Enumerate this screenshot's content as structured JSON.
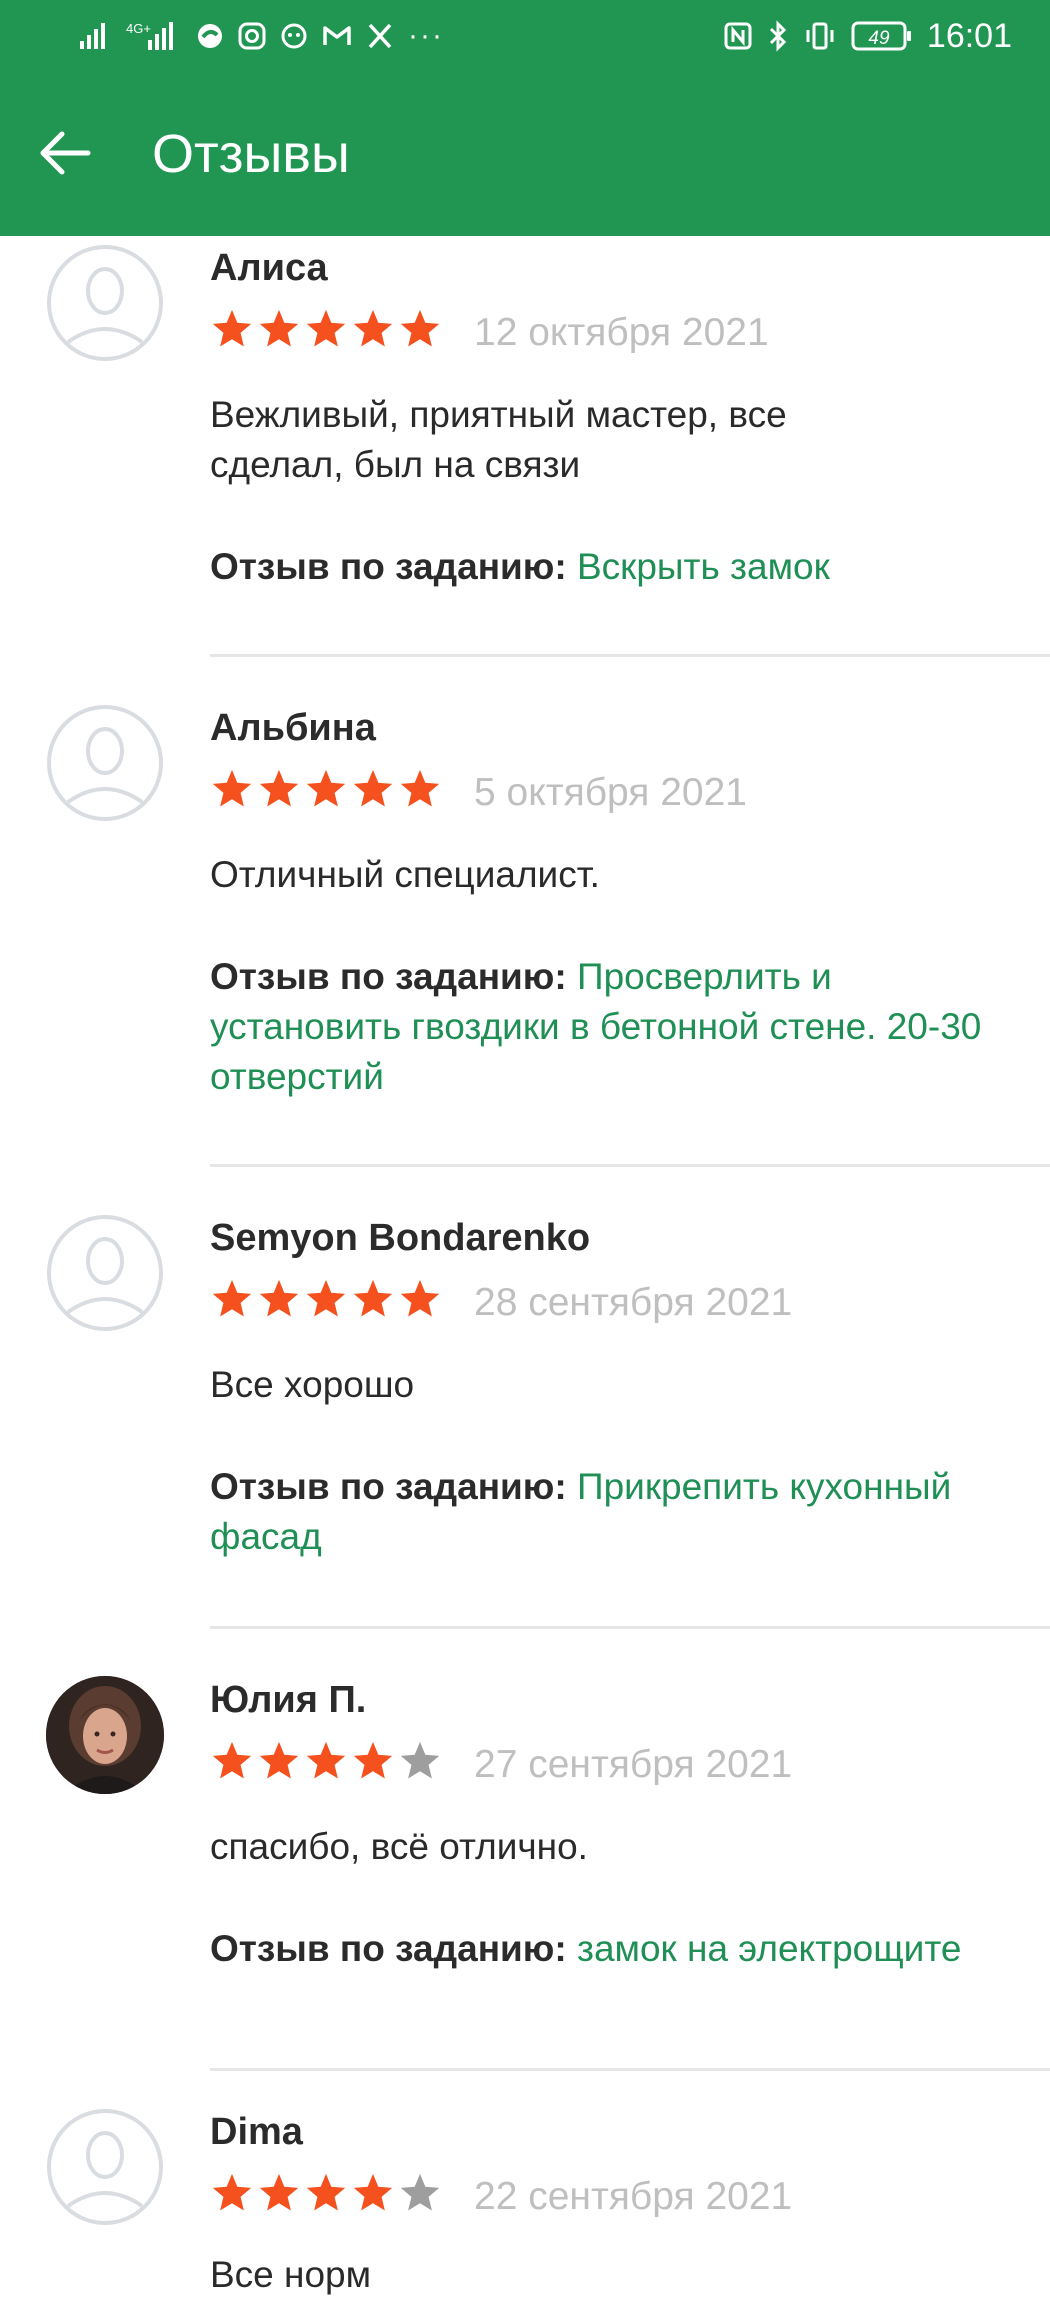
{
  "status_bar": {
    "signal1": "signal-icon",
    "network": "4G⁺",
    "more": "···",
    "time": "16:01",
    "battery": "49"
  },
  "app_bar": {
    "title": "Отзывы",
    "back_icon": "arrow-left-icon"
  },
  "colors": {
    "primary": "#219653",
    "link": "#1f8f55",
    "star_on": "#f4511e",
    "star_off": "#9e9e9e",
    "date": "#bfbfbf"
  },
  "task_label": "Отзыв по заданию:",
  "reviews": [
    {
      "name": "Алиса",
      "rating": 5,
      "date": "12 октября 2021",
      "text": "Вежливый, приятный мастер, все сделал, был на связи",
      "task": "Вскрыть замок",
      "avatar": "default"
    },
    {
      "name": "Альбина",
      "rating": 5,
      "date": "5 октября 2021",
      "text": "Отличный специалист.",
      "task": "Просверлить  и установить гвоздики в бетонной стене. 20-30 отверстий",
      "avatar": "default"
    },
    {
      "name": "Semyon Bondarenko",
      "rating": 5,
      "date": "28 сентября 2021",
      "text": "Все хорошо",
      "task": "Прикрепить кухонный фасад",
      "avatar": "default"
    },
    {
      "name": "Юлия П.",
      "rating": 4,
      "date": "27 сентября 2021",
      "text": "спасибо, всё отлично.",
      "task": "замок на электрощите",
      "avatar": "photo"
    },
    {
      "name": "Dima",
      "rating": 4,
      "date": "22 сентября 2021",
      "text": "Все норм",
      "task": "",
      "avatar": "default"
    }
  ]
}
